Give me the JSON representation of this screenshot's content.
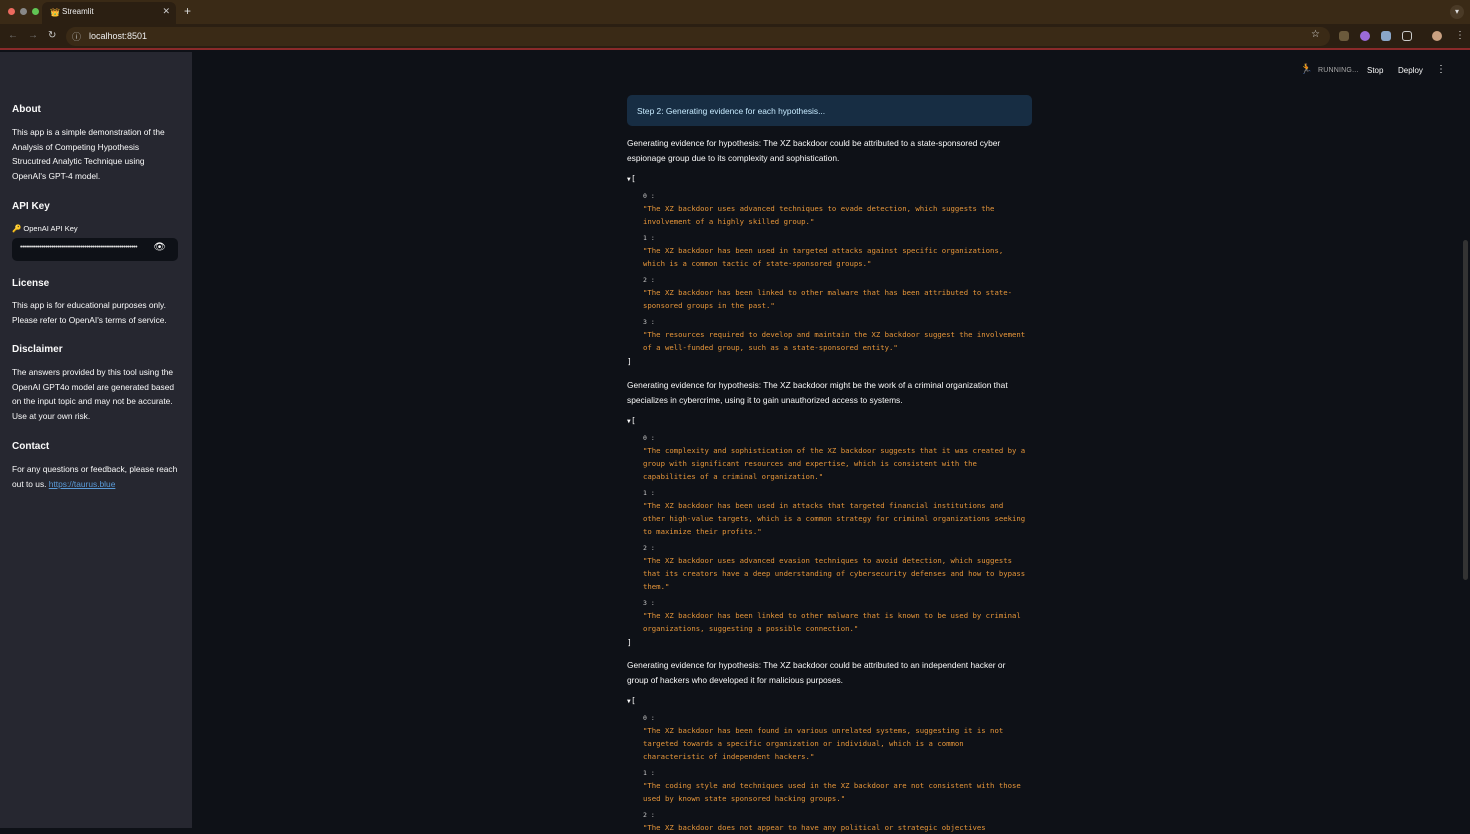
{
  "browser": {
    "tab_title": "Streamlit",
    "tab_icon": "👑",
    "close": "✕",
    "new_tab": "+",
    "url": "localhost:8501"
  },
  "sidebar": {
    "about_title": "About",
    "about_text": "This app is a simple demonstration of the Analysis of Competing Hypothesis Strucutred Analytic Technique using OpenAI's GPT-4 model.",
    "api_title": "API Key",
    "api_label": "🔑 OpenAI API Key",
    "api_value": "••••••••••••••••••••••••••••••••••••••••••••••••••••••••••••",
    "license_title": "License",
    "license_text": "This app is for educational purposes only. Please refer to OpenAI's terms of service.",
    "disclaimer_title": "Disclaimer",
    "disclaimer_text": "The answers provided by this tool using the OpenAI GPT4o model are generated based on the input topic and may not be accurate. Use at your own risk.",
    "contact_title": "Contact",
    "contact_text": "For any questions or feedback, please reach out to us.",
    "contact_link": "https://taurus.blue"
  },
  "status": {
    "running": "RUNNING...",
    "stop": "Stop",
    "deploy": "Deploy"
  },
  "main": {
    "info": "Step 2: Generating evidence for each hypothesis...",
    "hypotheses": [
      {
        "text": "Generating evidence for hypothesis: The XZ backdoor could be attributed to a state-sponsored cyber espionage group due to its complexity and sophistication.",
        "evidence": [
          "\"The XZ backdoor uses advanced techniques to evade detection, which suggests the involvement of a highly skilled group.\"",
          "\"The XZ backdoor has been used in targeted attacks against specific organizations, which is a common tactic of state-sponsored groups.\"",
          "\"The XZ backdoor has been linked to other malware that has been attributed to state-sponsored groups in the past.\"",
          "\"The resources required to develop and maintain the XZ backdoor suggest the involvement of a well-funded group, such as a state-sponsored entity.\""
        ]
      },
      {
        "text": "Generating evidence for hypothesis: The XZ backdoor might be the work of a criminal organization that specializes in cybercrime, using it to gain unauthorized access to systems.",
        "evidence": [
          "\"The complexity and sophistication of the XZ backdoor suggests that it was created by a group with significant resources and expertise, which is consistent with the capabilities of a criminal organization.\"",
          "\"The XZ backdoor has been used in attacks that targeted financial institutions and other high-value targets, which is a common strategy for criminal organizations seeking to maximize their profits.\"",
          "\"The XZ backdoor uses advanced evasion techniques to avoid detection, which suggests that its creators have a deep understanding of cybersecurity defenses and how to bypass them.\"",
          "\"The XZ backdoor has been linked to other malware that is known to be used by criminal organizations, suggesting a possible connection.\""
        ]
      },
      {
        "text": "Generating evidence for hypothesis: The XZ backdoor could be attributed to an independent hacker or group of hackers who developed it for malicious purposes.",
        "evidence": [
          "\"The XZ backdoor has been found in various unrelated systems, suggesting it is not targeted towards a specific organization or individual, which is a common characteristic of independent hackers.\"",
          "\"The coding style and techniques used in the XZ backdoor are not consistent with those used by known state sponsored hacking groups.\"",
          "\"The XZ backdoor does not appear to have any political or strategic objectives"
        ]
      }
    ]
  }
}
